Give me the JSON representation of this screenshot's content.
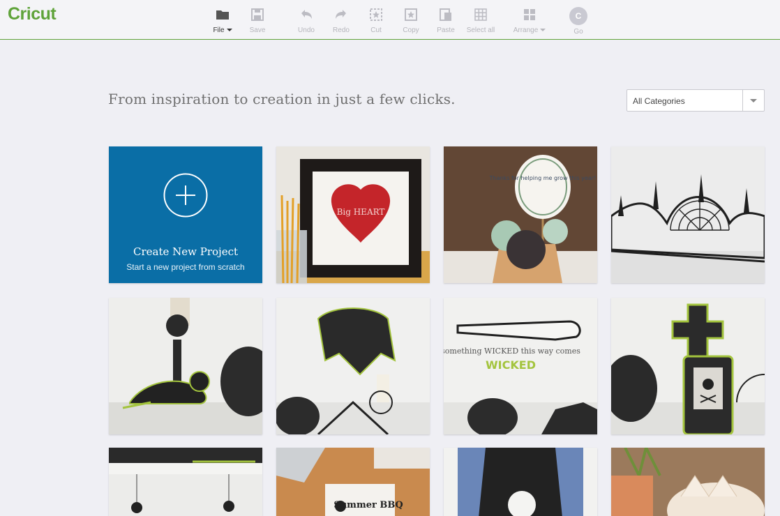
{
  "app": {
    "logo": "Cricut"
  },
  "toolbar": {
    "items": [
      {
        "label": "File",
        "icon": "folder-icon",
        "has_dropdown": true,
        "active": true
      },
      {
        "label": "Save",
        "icon": "save-icon"
      },
      {
        "label": "Undo",
        "icon": "undo-icon"
      },
      {
        "label": "Redo",
        "icon": "redo-icon"
      },
      {
        "label": "Cut",
        "icon": "cut-icon"
      },
      {
        "label": "Copy",
        "icon": "copy-icon"
      },
      {
        "label": "Paste",
        "icon": "paste-icon"
      },
      {
        "label": "Select all",
        "icon": "select-all-icon"
      },
      {
        "label": "Arrange",
        "icon": "arrange-icon",
        "has_dropdown": true
      },
      {
        "label": "Go",
        "icon": "avatar",
        "avatar_initial": "C"
      }
    ]
  },
  "main": {
    "headline": "From inspiration to creation in just a few clicks.",
    "category_select": {
      "value": "All Categories"
    },
    "create_tile": {
      "title": "Create New Project",
      "subtitle": "Start a new project from scratch"
    },
    "project_tiles": [
      {
        "name": "framed-red-heart-project",
        "text": "Big HEART"
      },
      {
        "name": "succulent-thank-you-project",
        "text": "Thanks for helping me grow this year!"
      },
      {
        "name": "spiderweb-fence-project"
      },
      {
        "name": "halloween-rat-project"
      },
      {
        "name": "raven-wreath-project"
      },
      {
        "name": "something-wicked-sign-project",
        "text": "something WICKED this way comes"
      },
      {
        "name": "tombstone-skull-project"
      },
      {
        "name": "hanging-spiders-project"
      },
      {
        "name": "summer-bbq-invite-project",
        "text": "Summer BBQ"
      },
      {
        "name": "skull-apron-project"
      },
      {
        "name": "paper-flower-project"
      }
    ]
  },
  "colors": {
    "brand_green": "#5fa33a",
    "create_blue": "#0a6ea6",
    "background": "#efeff4"
  }
}
